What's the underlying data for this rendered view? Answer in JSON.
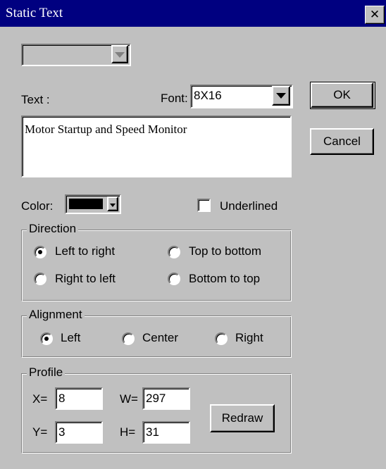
{
  "window": {
    "title": "Static Text",
    "close_glyph": "✕"
  },
  "top_combo": {
    "value": ""
  },
  "text_label": "Text :",
  "font": {
    "label": "Font:",
    "value": "8X16"
  },
  "text_value": "Motor Startup and Speed Monitor",
  "buttons": {
    "ok": "OK",
    "cancel": "Cancel",
    "redraw": "Redraw"
  },
  "color": {
    "label": "Color:",
    "swatch": "#000000"
  },
  "underlined": {
    "label": "Underlined",
    "checked": false
  },
  "direction": {
    "title": "Direction",
    "options": [
      "Left to right",
      "Top to bottom",
      "Right to left",
      "Bottom to top"
    ],
    "selected": "Left to right"
  },
  "alignment": {
    "title": "Alignment",
    "options": [
      "Left",
      "Center",
      "Right"
    ],
    "selected": "Left"
  },
  "profile": {
    "title": "Profile",
    "x_label": "X=",
    "x_value": "8",
    "y_label": "Y=",
    "y_value": "3",
    "w_label": "W=",
    "w_value": "297",
    "h_label": "H=",
    "h_value": "31"
  }
}
